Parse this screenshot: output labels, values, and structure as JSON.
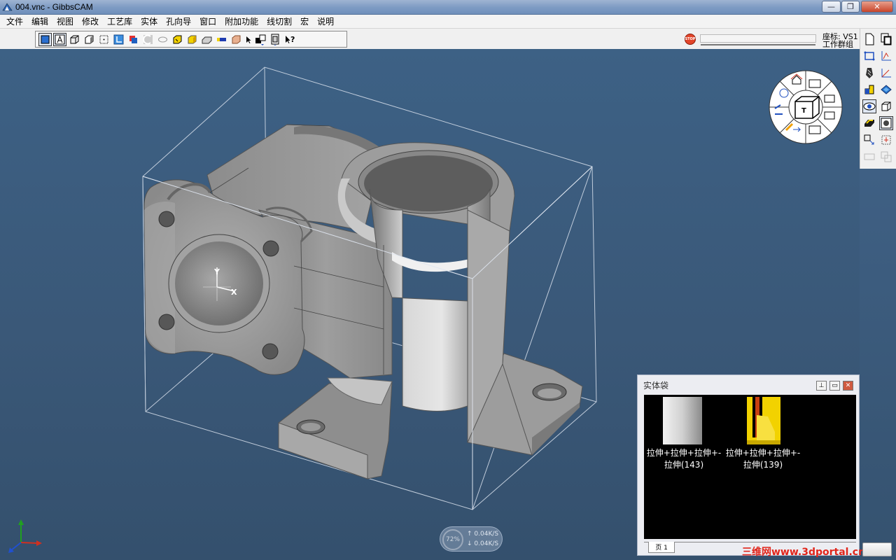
{
  "window": {
    "title": "004.vnc - GibbsCAM",
    "minimize": "—",
    "restore": "❐",
    "close": "✕"
  },
  "menu": [
    "文件",
    "编辑",
    "视图",
    "修改",
    "工艺库",
    "实体",
    "孔向导",
    "窗口",
    "附加功能",
    "线切割",
    "宏",
    "说明"
  ],
  "toolbar": {
    "stop_label": "STOP",
    "coord_line1": "座标: VS1",
    "coord_line2": "工作群组"
  },
  "solid_bag": {
    "title": "实体袋",
    "items": [
      {
        "line1": "拉伸+拉伸+拉伸+-",
        "line2": "拉伸(143)"
      },
      {
        "line1": "拉伸+拉伸+拉伸+-",
        "line2": "拉伸(139)"
      }
    ],
    "tab": "页 1"
  },
  "axis_labels": {
    "y": "Y",
    "x": "X"
  },
  "net": {
    "percent": "72%",
    "up": "↑ 0.04K/S",
    "down": "↓ 0.04K/S"
  },
  "watermark": "三维网www.3dportal.cn",
  "colors": {
    "viewport": "#3b5a7c",
    "part": "#9a9a9a",
    "highlight": "#f0d000"
  }
}
